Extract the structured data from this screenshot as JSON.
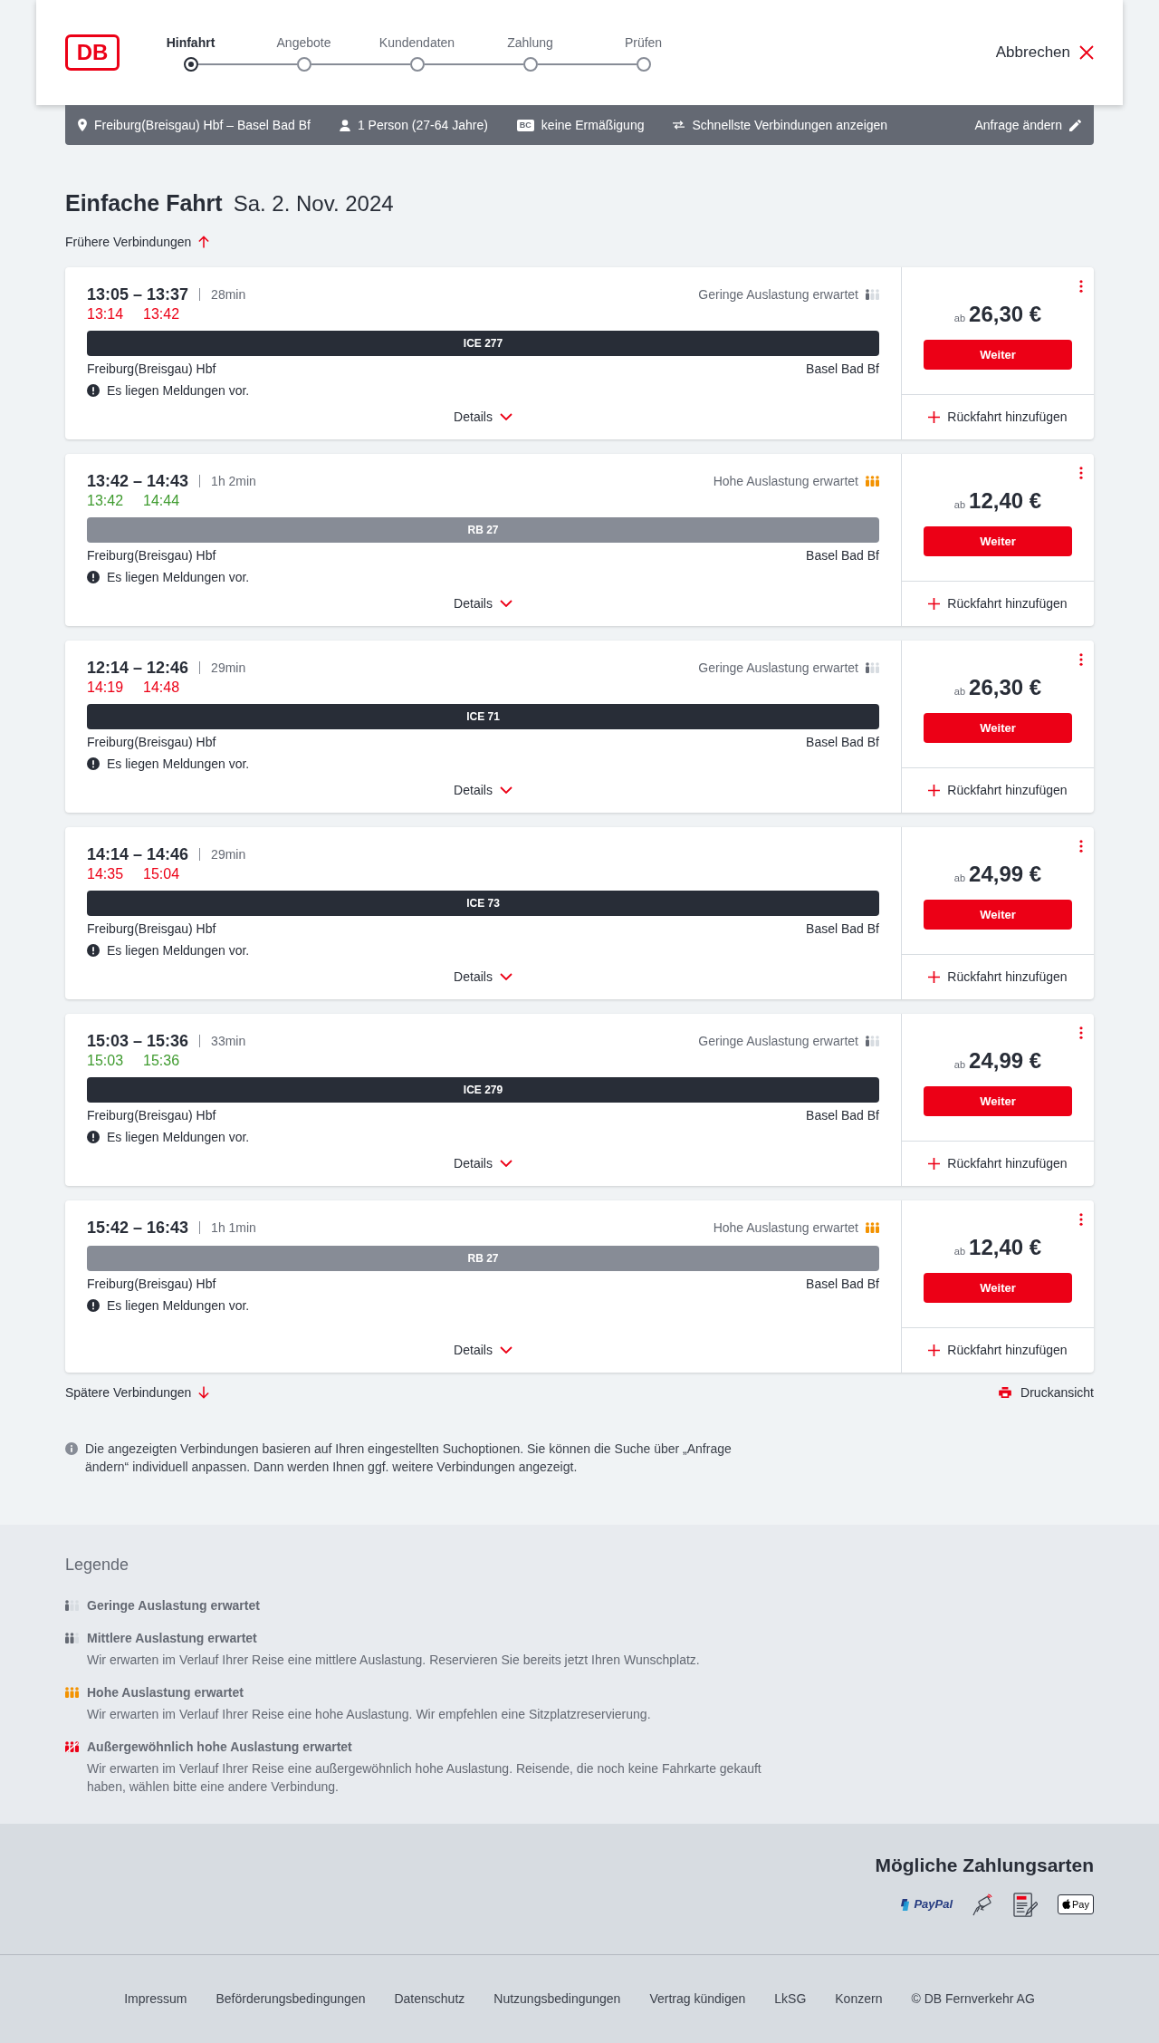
{
  "header": {
    "logo": "DB",
    "steps": [
      {
        "label": "Hinfahrt",
        "selected": true
      },
      {
        "label": "Angebote",
        "selected": false
      },
      {
        "label": "Kundendaten",
        "selected": false
      },
      {
        "label": "Zahlung",
        "selected": false
      },
      {
        "label": "Prüfen",
        "selected": false
      }
    ],
    "cancel": "Abbrechen"
  },
  "search_summary": {
    "route": "Freiburg(Breisgau) Hbf – Basel Bad Bf",
    "passengers": "1 Person (27-64 Jahre)",
    "discount_badge": "BC",
    "discount": "keine Ermäßigung",
    "preference": "Schnellste Verbindungen anzeigen",
    "edit": "Anfrage ändern"
  },
  "heading": {
    "title": "Einfache Fahrt",
    "date": "Sa. 2. Nov. 2024"
  },
  "earlier_link": "Frühere Verbindungen",
  "connections": [
    {
      "times": "13:05 – 13:37",
      "duration": "28min",
      "realtime": {
        "departure": "13:14",
        "arrival": "13:42",
        "on_time": false
      },
      "occupancy": {
        "kind": "low",
        "label": "Geringe Auslastung erwartet"
      },
      "train": {
        "kind": "ice",
        "name": "ICE 277"
      },
      "from": "Freiburg(Breisgau) Hbf",
      "to": "Basel Bad Bf",
      "notice": "Es liegen Meldungen vor.",
      "details": "Details",
      "price_prefix": "ab",
      "price": "26,30 €",
      "book": "Weiter",
      "add_return": "Rückfahrt hinzufügen"
    },
    {
      "times": "13:42 – 14:43",
      "duration": "1h 2min",
      "realtime": {
        "departure": "13:42",
        "arrival": "14:44",
        "on_time": true
      },
      "occupancy": {
        "kind": "high",
        "label": "Hohe Auslastung erwartet"
      },
      "train": {
        "kind": "regional",
        "name": "RB 27"
      },
      "from": "Freiburg(Breisgau) Hbf",
      "to": "Basel Bad Bf",
      "notice": "Es liegen Meldungen vor.",
      "details": "Details",
      "price_prefix": "ab",
      "price": "12,40 €",
      "book": "Weiter",
      "add_return": "Rückfahrt hinzufügen"
    },
    {
      "times": "12:14 – 12:46",
      "duration": "29min",
      "realtime": {
        "departure": "14:19",
        "arrival": "14:48",
        "on_time": false
      },
      "occupancy": {
        "kind": "low",
        "label": "Geringe Auslastung erwartet"
      },
      "train": {
        "kind": "ice",
        "name": "ICE 71"
      },
      "from": "Freiburg(Breisgau) Hbf",
      "to": "Basel Bad Bf",
      "notice": "Es liegen Meldungen vor.",
      "details": "Details",
      "price_prefix": "ab",
      "price": "26,30 €",
      "book": "Weiter",
      "add_return": "Rückfahrt hinzufügen"
    },
    {
      "times": "14:14 – 14:46",
      "duration": "29min",
      "realtime": {
        "departure": "14:35",
        "arrival": "15:04",
        "on_time": false
      },
      "train": {
        "kind": "ice",
        "name": "ICE 73"
      },
      "from": "Freiburg(Breisgau) Hbf",
      "to": "Basel Bad Bf",
      "notice": "Es liegen Meldungen vor.",
      "details": "Details",
      "price_prefix": "ab",
      "price": "24,99 €",
      "book": "Weiter",
      "add_return": "Rückfahrt hinzufügen"
    },
    {
      "times": "15:03 – 15:36",
      "duration": "33min",
      "realtime": {
        "departure": "15:03",
        "arrival": "15:36",
        "on_time": true
      },
      "occupancy": {
        "kind": "low",
        "label": "Geringe Auslastung erwartet"
      },
      "train": {
        "kind": "ice",
        "name": "ICE 279"
      },
      "from": "Freiburg(Breisgau) Hbf",
      "to": "Basel Bad Bf",
      "notice": "Es liegen Meldungen vor.",
      "details": "Details",
      "price_prefix": "ab",
      "price": "24,99 €",
      "book": "Weiter",
      "add_return": "Rückfahrt hinzufügen"
    },
    {
      "times": "15:42 – 16:43",
      "duration": "1h 1min",
      "occupancy": {
        "kind": "high",
        "label": "Hohe Auslastung erwartet"
      },
      "train": {
        "kind": "regional",
        "name": "RB 27"
      },
      "from": "Freiburg(Breisgau) Hbf",
      "to": "Basel Bad Bf",
      "notice": "Es liegen Meldungen vor.",
      "details": "Details",
      "price_prefix": "ab",
      "price": "12,40 €",
      "book": "Weiter",
      "add_return": "Rückfahrt hinzufügen"
    }
  ],
  "later_link": "Spätere Verbindungen",
  "print_link": "Druckansicht",
  "info_note": "Die angezeigten Verbindungen basieren auf Ihren eingestellten Suchoptionen. Sie können die Suche über „Anfrage ändern“ individuell anpassen. Dann werden Ihnen ggf. weitere Verbindungen angezeigt.",
  "legend": {
    "title": "Legende",
    "items": [
      {
        "kind": "low",
        "title": "Geringe Auslastung erwartet"
      },
      {
        "kind": "medium",
        "title": "Mittlere Auslastung erwartet",
        "description": "Wir erwarten im Verlauf Ihrer Reise eine mittlere Auslastung. Reservieren Sie bereits jetzt Ihren Wunschplatz."
      },
      {
        "kind": "high",
        "title": "Hohe Auslastung erwartet",
        "description": "Wir erwarten im Verlauf Ihrer Reise eine hohe Auslastung. Wir empfehlen eine Sitzplatzreservierung."
      },
      {
        "kind": "exceptional",
        "title": "Außergewöhnlich hohe Auslastung erwartet",
        "description": "Wir erwarten im Verlauf Ihrer Reise eine außergewöhnlich hohe Auslastung. Reisende, die noch keine Fahrkarte gekauft haben, wählen bitte eine andere Verbindung."
      }
    ]
  },
  "payment": {
    "title": "Mögliche Zahlungsarten",
    "methods": [
      {
        "kind": "paypal",
        "label": "PayPal"
      },
      {
        "kind": "contactless"
      },
      {
        "kind": "sepa"
      },
      {
        "kind": "apple_pay",
        "label": "Pay"
      }
    ]
  },
  "footer_links": [
    "Impressum",
    "Beförderungsbedingungen",
    "Datenschutz",
    "Nutzungsbedingungen",
    "Vertrag kündigen",
    "LkSG",
    "Konzern",
    "© DB Fernverkehr AG"
  ]
}
